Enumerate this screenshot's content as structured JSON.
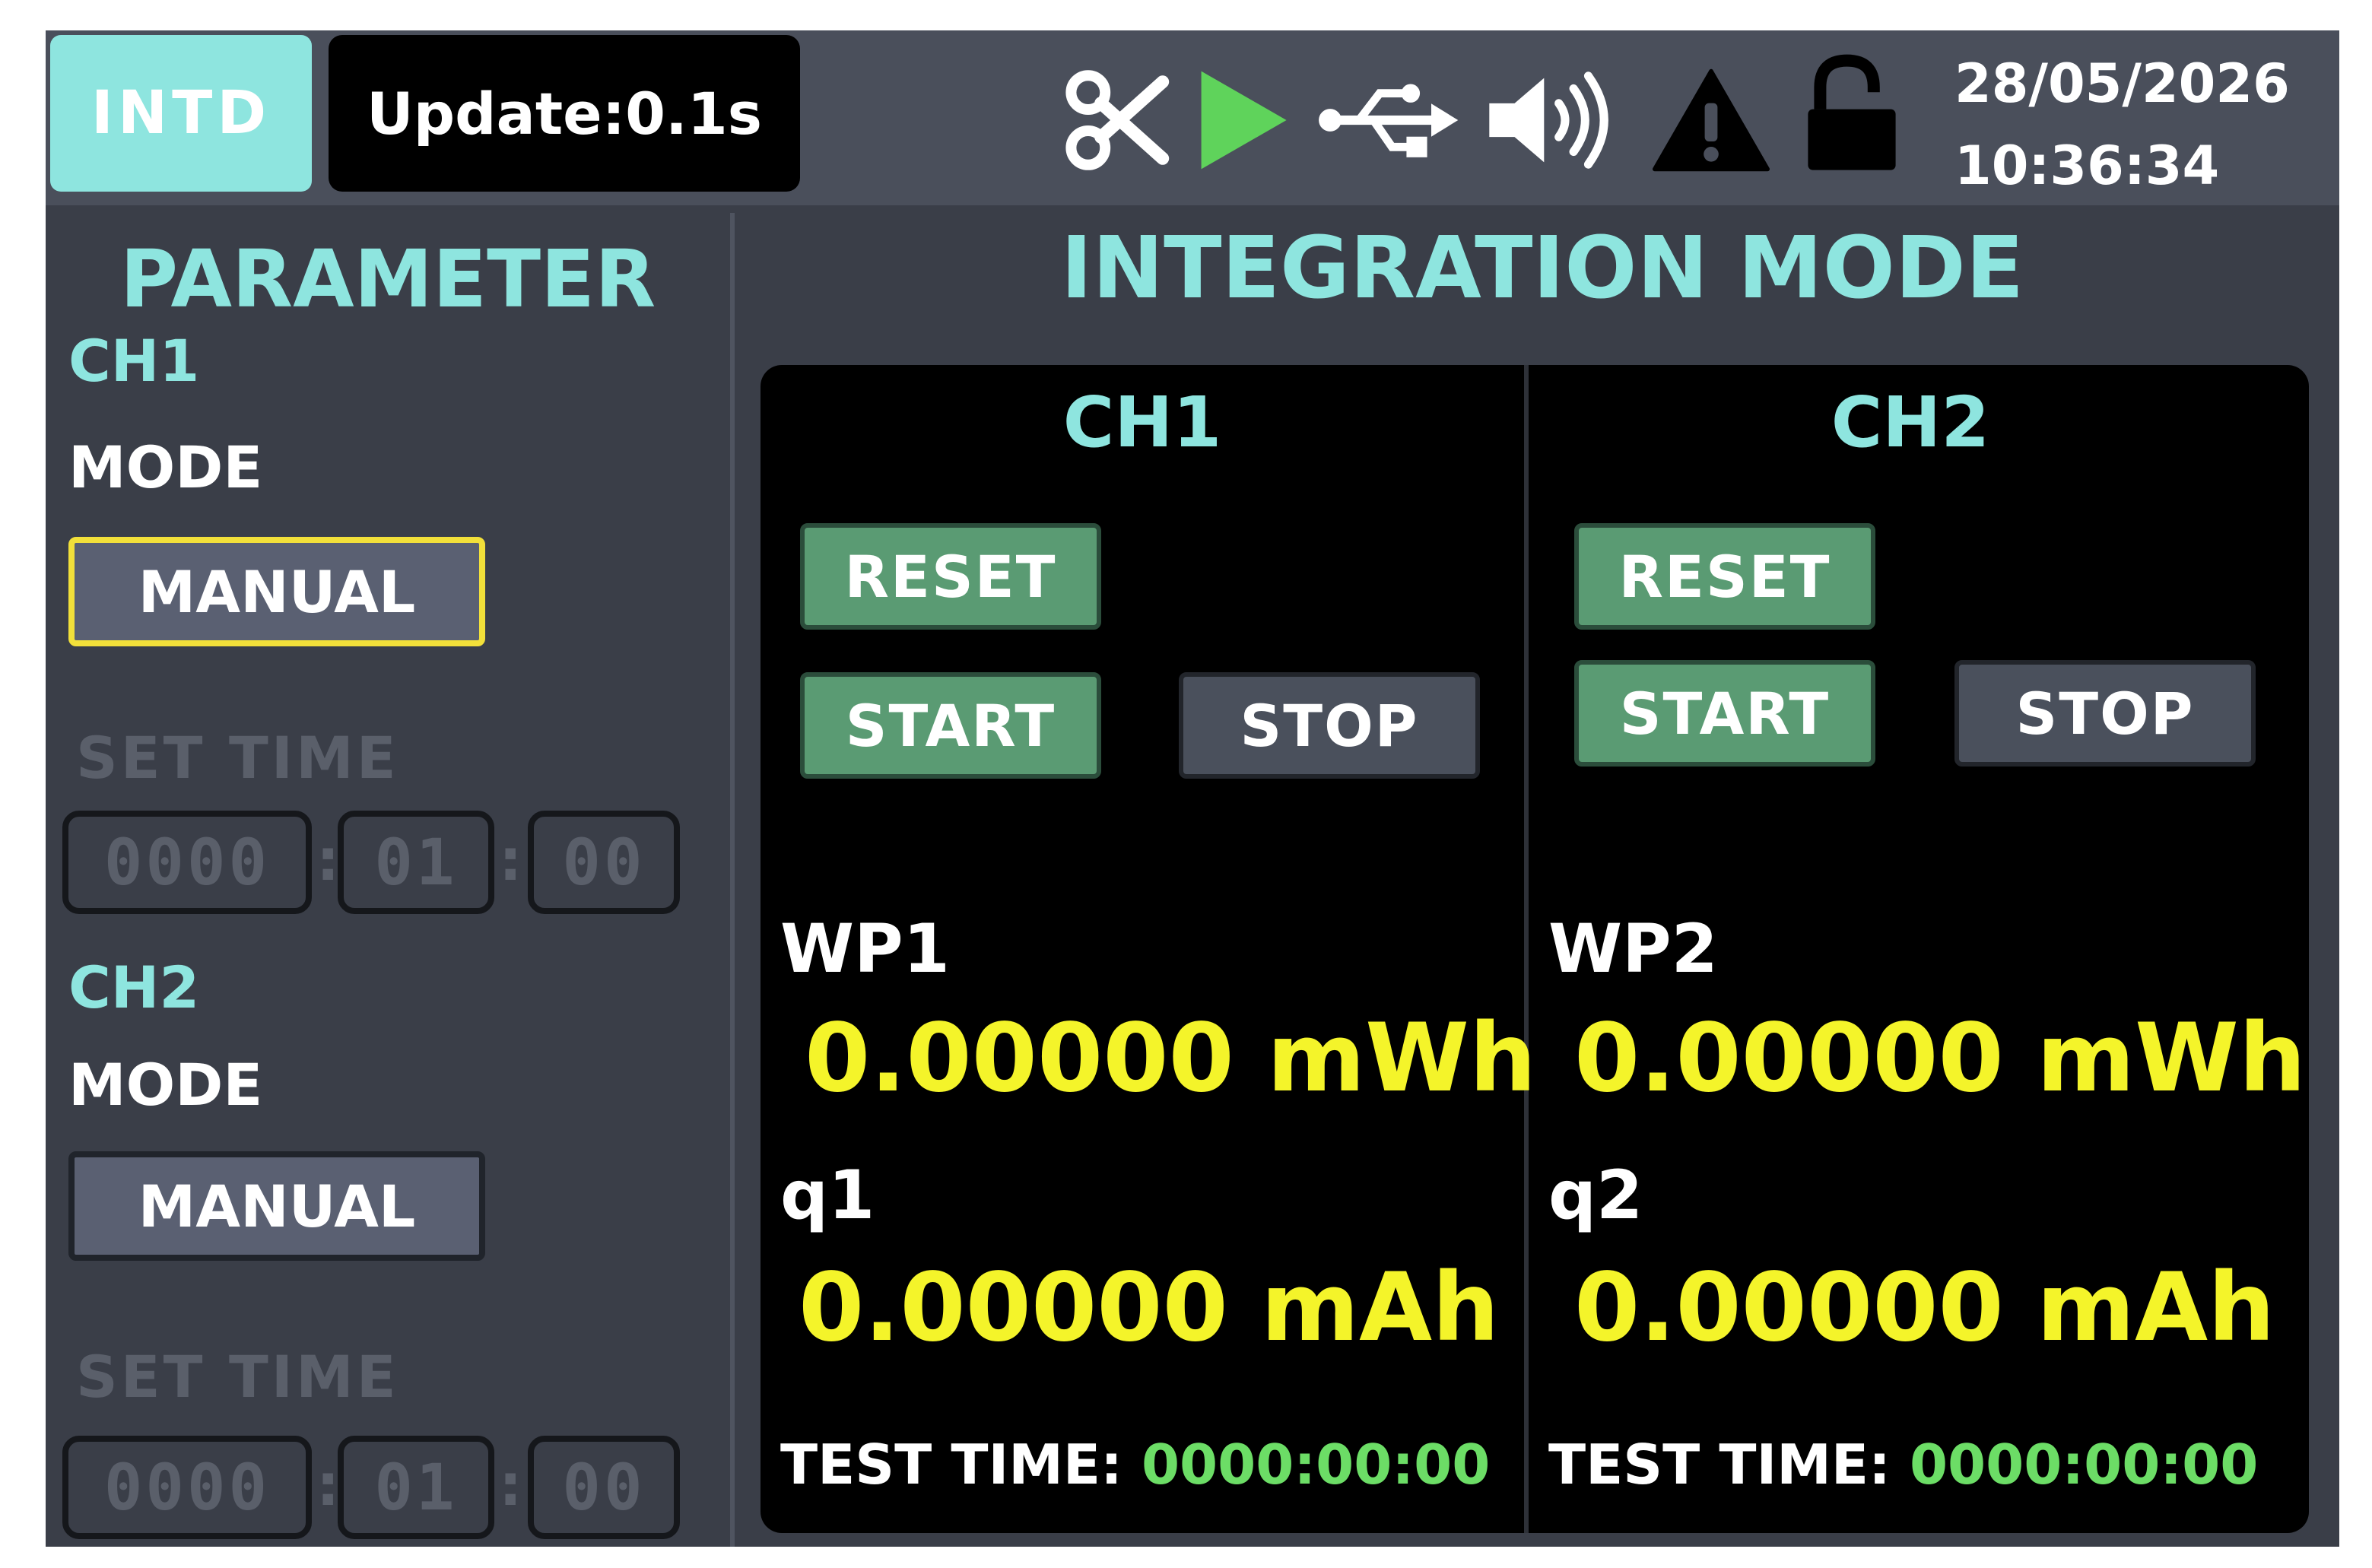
{
  "topbar": {
    "mode_badge": "INTD",
    "update_text": "Update:0.1s",
    "icons": [
      "scissors-icon",
      "play-icon",
      "usb-icon",
      "speaker-icon",
      "warning-icon",
      "unlock-icon"
    ],
    "date": "28/05/2026",
    "time": "10:36:34"
  },
  "colors": {
    "accent": "#8ee5df",
    "value_yellow": "#f4f42a",
    "time_green": "#6cdd66",
    "button_green": "#5a9b73",
    "play_green": "#5fd35b",
    "selected_border": "#f2e03a"
  },
  "parameter": {
    "title": "PARAMETER",
    "ch1": {
      "label": "CH1",
      "mode_label": "MODE",
      "mode_value": "MANUAL",
      "set_time_label": "SET TIME",
      "hours": "0000",
      "minutes": "01",
      "seconds": "00"
    },
    "ch2": {
      "label": "CH2",
      "mode_label": "MODE",
      "mode_value": "MANUAL",
      "set_time_label": "SET TIME",
      "hours": "0000",
      "minutes": "01",
      "seconds": "00"
    },
    "colon": ":"
  },
  "main": {
    "title": "INTEGRATION MODE",
    "ch1": {
      "title": "CH1",
      "reset": "RESET",
      "start": "START",
      "stop": "STOP",
      "energy_label": "WP1",
      "energy_value": "0.00000 mWh",
      "charge_label": "q1",
      "charge_value": "0.00000 mAh",
      "test_time_label": "TEST TIME:",
      "test_time_value": "0000:00:00"
    },
    "ch2": {
      "title": "CH2",
      "reset": "RESET",
      "start": "START",
      "stop": "STOP",
      "energy_label": "WP2",
      "energy_value": "0.00000 mWh",
      "charge_label": "q2",
      "charge_value": "0.00000 mAh",
      "test_time_label": "TEST TIME:",
      "test_time_value": "0000:00:00"
    }
  }
}
